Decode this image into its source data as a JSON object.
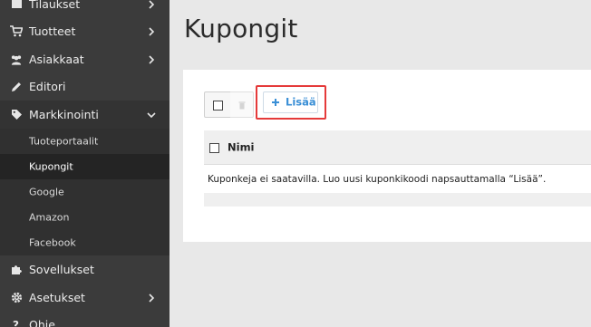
{
  "sidebar": {
    "items": [
      {
        "label": "Tilaukset",
        "icon": "orders-icon",
        "has_chevron": true
      },
      {
        "label": "Tuotteet",
        "icon": "cart-icon",
        "has_chevron": true
      },
      {
        "label": "Asiakkaat",
        "icon": "users-icon",
        "has_chevron": true
      },
      {
        "label": "Editori",
        "icon": "pencil-icon",
        "has_chevron": false
      },
      {
        "label": "Markkinointi",
        "icon": "tag-icon",
        "has_chevron": true,
        "expanded": true
      },
      {
        "label": "Sovellukset",
        "icon": "puzzle-icon",
        "has_chevron": false
      },
      {
        "label": "Asetukset",
        "icon": "gear-icon",
        "has_chevron": true
      },
      {
        "label": "Ohje",
        "icon": "help-icon",
        "has_chevron": false
      }
    ],
    "submenu": [
      {
        "label": "Tuoteportaalit"
      },
      {
        "label": "Kupongit",
        "active": true
      },
      {
        "label": "Google"
      },
      {
        "label": "Amazon"
      },
      {
        "label": "Facebook"
      }
    ]
  },
  "main": {
    "title": "Kupongit",
    "toolbar": {
      "add_label": "Lisää",
      "add_icon": "plus-icon",
      "select_all_icon": "checkbox-icon",
      "delete_icon": "trash-icon"
    },
    "table": {
      "columns": [
        "Nimi"
      ],
      "empty_message": "Kuponkeja ei saatavilla. Luo uusi kuponkikoodi napsauttamalla “Lisää”."
    }
  },
  "colors": {
    "sidebar_bg": "#3b3b3b",
    "active_bg": "#242424",
    "accent": "#3a8fd6",
    "highlight": "#e53a3a"
  }
}
